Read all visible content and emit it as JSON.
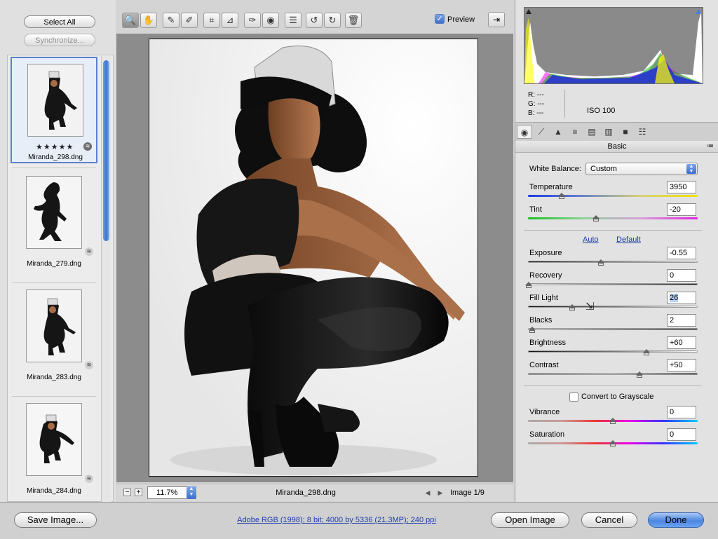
{
  "left_panel": {
    "select_all": "Select All",
    "synchronize": "Synchronize...",
    "thumbnails": [
      {
        "name": "Miranda_298.dng",
        "stars": "★★★★★",
        "selected": true
      },
      {
        "name": "Miranda_279.dng",
        "stars": "",
        "selected": false
      },
      {
        "name": "Miranda_283.dng",
        "stars": "",
        "selected": false
      },
      {
        "name": "Miranda_284.dng",
        "stars": "",
        "selected": false
      }
    ]
  },
  "toolbar": {
    "preview_label": "Preview",
    "preview_checked": true,
    "tools": [
      "zoom-icon",
      "hand-icon",
      "white-balance-icon",
      "color-sampler-icon",
      "crop-icon",
      "straighten-icon",
      "retouch-icon",
      "red-eye-icon",
      "preferences-icon",
      "rotate-left-icon",
      "rotate-right-icon",
      "trash-icon"
    ]
  },
  "canvas_status": {
    "zoom": "11.7%",
    "filename": "Miranda_298.dng",
    "image_count": "Image 1/9"
  },
  "info": {
    "r": "---",
    "g": "---",
    "b": "---",
    "iso": "ISO 100"
  },
  "panel": {
    "section_title": "Basic",
    "white_balance_label": "White Balance:",
    "white_balance_value": "Custom",
    "auto": "Auto",
    "default": "Default",
    "convert_grayscale": "Convert to Grayscale",
    "sliders": {
      "temperature": {
        "label": "Temperature",
        "value": "3950",
        "pos": 0.2
      },
      "tint": {
        "label": "Tint",
        "value": "-20",
        "pos": 0.4
      },
      "exposure": {
        "label": "Exposure",
        "value": "-0.55",
        "pos": 0.43
      },
      "recovery": {
        "label": "Recovery",
        "value": "0",
        "pos": 0.0
      },
      "fill_light": {
        "label": "Fill Light",
        "value": "26",
        "pos": 0.26
      },
      "blacks": {
        "label": "Blacks",
        "value": "2",
        "pos": 0.02
      },
      "brightness": {
        "label": "Brightness",
        "value": "+60",
        "pos": 0.7
      },
      "contrast": {
        "label": "Contrast",
        "value": "+50",
        "pos": 0.66
      },
      "vibrance": {
        "label": "Vibrance",
        "value": "0",
        "pos": 0.5
      },
      "saturation": {
        "label": "Saturation",
        "value": "0",
        "pos": 0.5
      }
    }
  },
  "bottom": {
    "save_image": "Save Image...",
    "workflow": "Adobe RGB (1998); 8 bit; 4000 by 5336 (21.3MP); 240 ppi",
    "open_image": "Open Image",
    "cancel": "Cancel",
    "done": "Done"
  },
  "colors": {
    "accent": "#3b6ed0",
    "link": "#1c3ea8",
    "canvas_bg": "#8c8c8c"
  }
}
